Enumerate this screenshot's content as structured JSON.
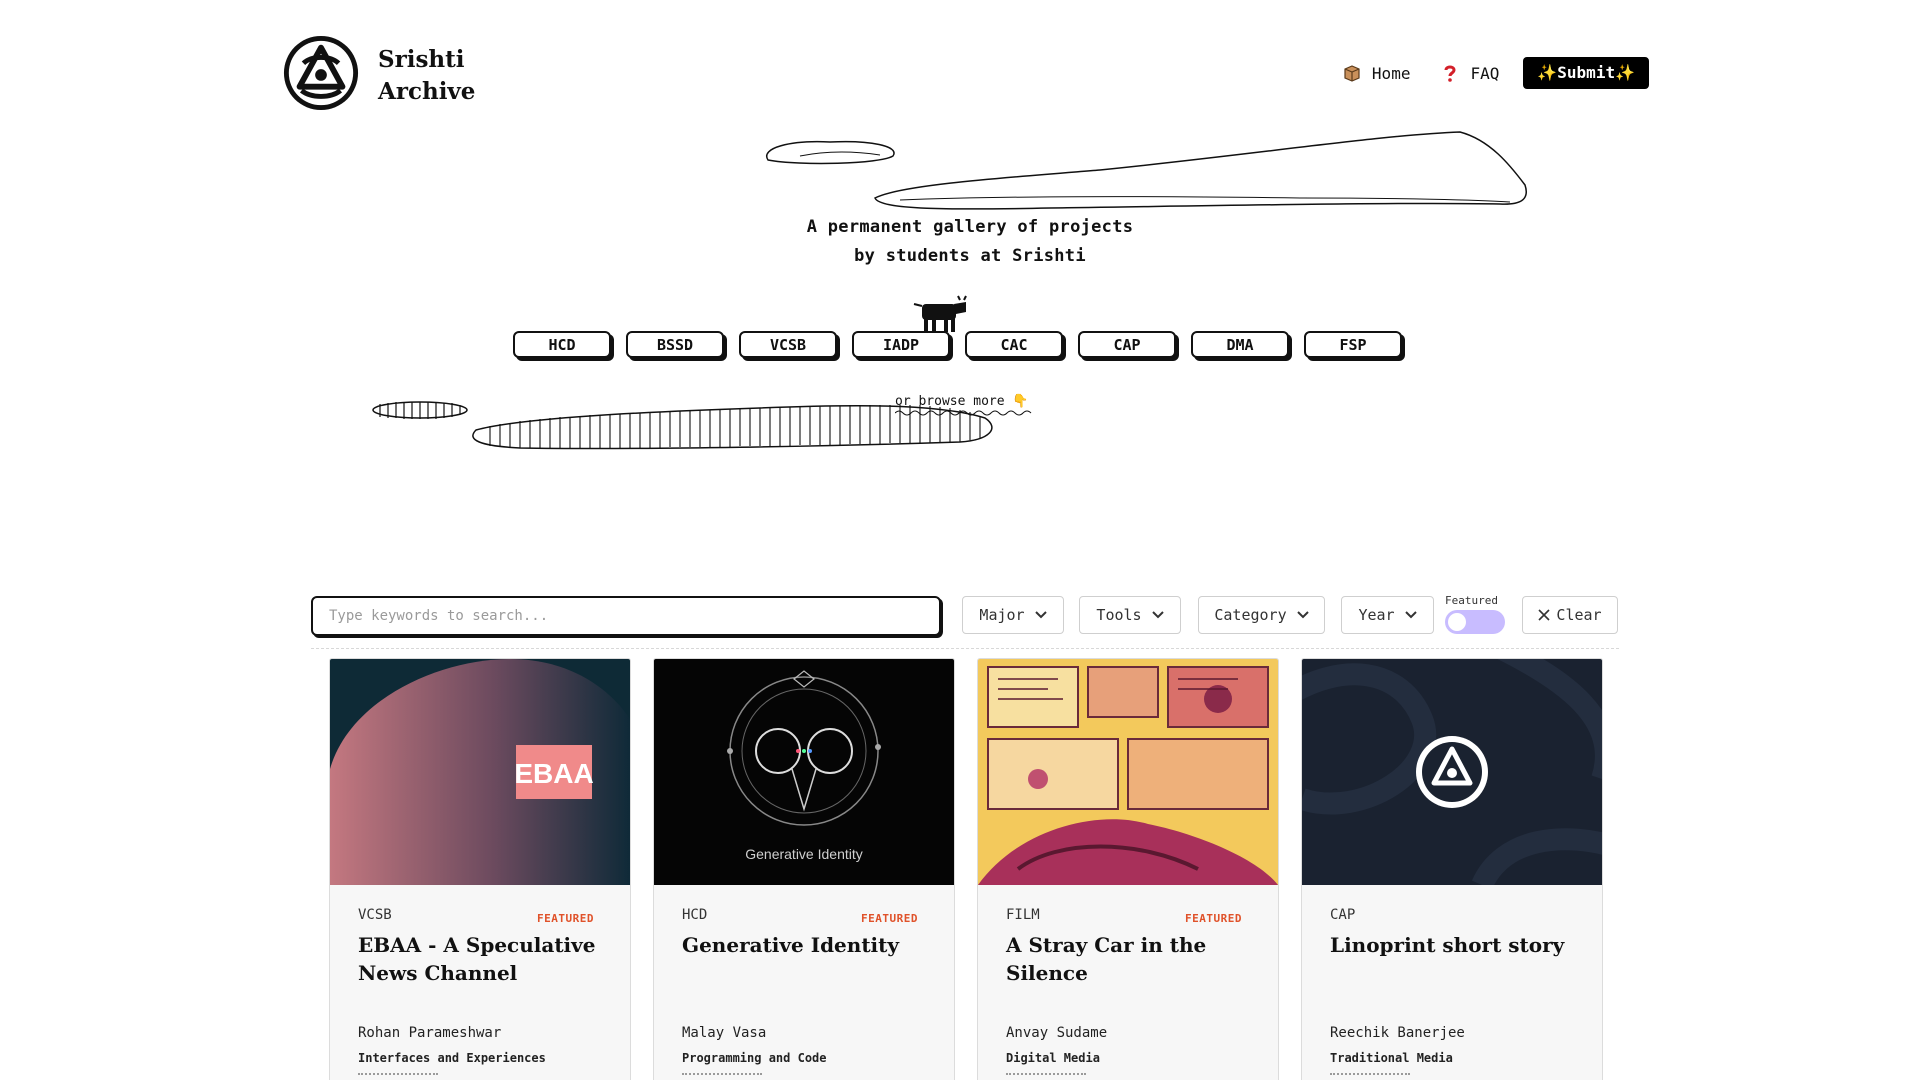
{
  "header": {
    "brand_line1": "Srishti",
    "brand_line2": "Archive",
    "logo_icon": "srishti-logo-icon"
  },
  "nav": {
    "home_label": "Home",
    "home_icon": "box-icon",
    "faq_label": "FAQ",
    "faq_icon": "question-mark-icon",
    "submit_label": "Submit",
    "submit_sparkle": "✨"
  },
  "hero": {
    "tagline_line1": "A permanent gallery of projects",
    "tagline_line2": "by students at Srishti",
    "majors": [
      "HCD",
      "BSSD",
      "VCSB",
      "IADP",
      "CAC",
      "CAP",
      "DMA",
      "FSP"
    ],
    "browse_more": "or browse more 👇"
  },
  "filters": {
    "search_placeholder": "Type keywords to search...",
    "dropdowns": [
      "Major",
      "Tools",
      "Category",
      "Year"
    ],
    "featured_label": "Featured",
    "featured_on": false,
    "clear_label": "Clear"
  },
  "cards": [
    {
      "major": "VCSB",
      "featured": "FEATURED",
      "title": "EBAA - A Speculative News Channel",
      "author": "Rohan Parameshwar",
      "category": "Interfaces and Experiences",
      "thumb_text": "EBAA"
    },
    {
      "major": "HCD",
      "featured": "FEATURED",
      "title": "Generative Identity",
      "author": "Malay Vasa",
      "category": "Programming and Code",
      "thumb_text": "Generative Identity"
    },
    {
      "major": "FILM",
      "featured": "FEATURED",
      "title": "A Stray Car in the Silence",
      "author": "Anvay Sudame",
      "category": "Digital Media",
      "thumb_text": ""
    },
    {
      "major": "CAP",
      "featured": "",
      "title": "Linoprint short story",
      "author": "Reechik Banerjee",
      "category": "Traditional Media",
      "thumb_text": ""
    }
  ],
  "colors": {
    "accent_featured": "#e0522a",
    "toggle": "#c8bcff",
    "submit_bg": "#000000"
  }
}
